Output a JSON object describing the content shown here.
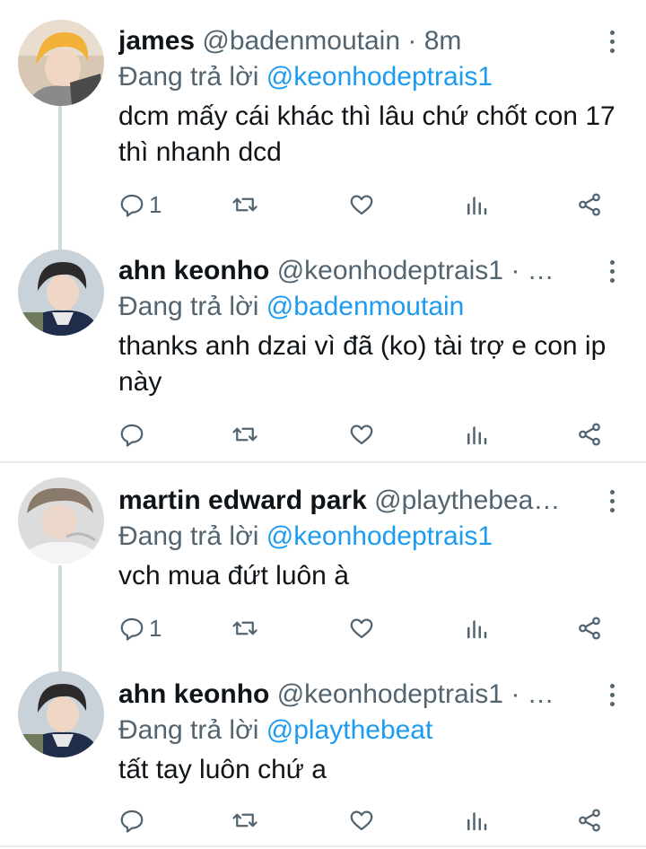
{
  "tweets": [
    {
      "name": "james",
      "handle": "@badenmoutain · 8m",
      "replying_prefix": "Đang trả lời ",
      "replying_to": "@keonhodeptrais1",
      "text": "dcm mấy cái khác thì lâu chứ chốt con 17 thì nhanh dcd",
      "reply_count": "1"
    },
    {
      "name": "ahn keonho",
      "handle": "@keonhodeptrais1 · …",
      "replying_prefix": "Đang trả lời ",
      "replying_to": "@badenmoutain",
      "text": "thanks anh dzai vì đã (ko) tài trợ e con ip này",
      "reply_count": ""
    },
    {
      "name": "martin edward park",
      "handle": "@playthebea…",
      "replying_prefix": "Đang trả lời ",
      "replying_to": "@keonhodeptrais1",
      "text": "vch mua đứt luôn à",
      "reply_count": "1"
    },
    {
      "name": "ahn keonho",
      "handle": "@keonhodeptrais1 · …",
      "replying_prefix": "Đang trả lời ",
      "replying_to": "@playthebeat",
      "text": "tất tay luôn chứ a",
      "reply_count": ""
    }
  ],
  "icons": {
    "reply": "reply-icon",
    "retweet": "retweet-icon",
    "like": "like-icon",
    "views": "views-icon",
    "share": "share-icon",
    "more": "more-icon"
  },
  "colors": {
    "link": "#1d9bf0",
    "secondary_text": "#536471",
    "thread_line": "#cfd9de",
    "divider": "#e6ecf0"
  }
}
